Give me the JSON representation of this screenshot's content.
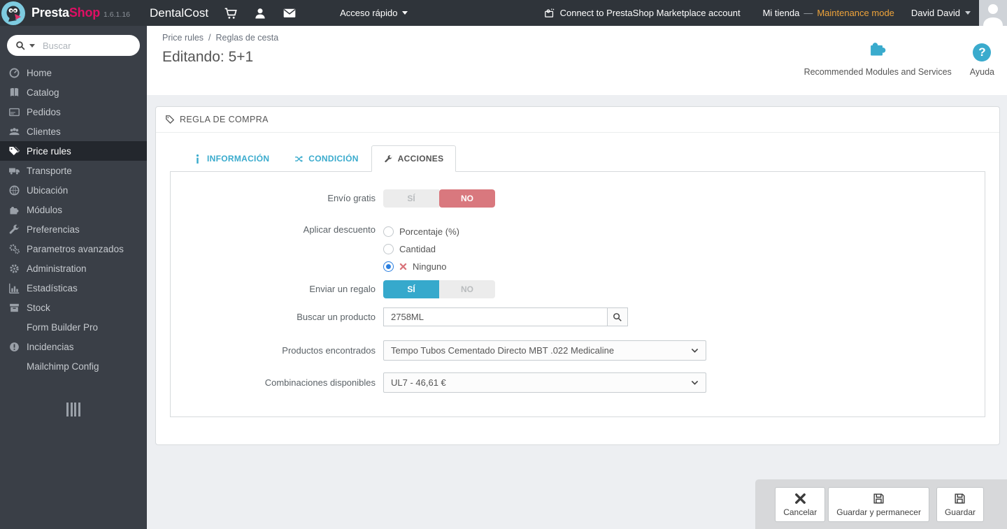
{
  "topbar": {
    "brand_presta": "Presta",
    "brand_shop": "Shop",
    "version": "1.6.1.16",
    "shop_name": "DentalCost",
    "quick_access": "Acceso rápido",
    "marketplace": "Connect to PrestaShop Marketplace account",
    "store_name": "Mi tienda",
    "store_sep": "—",
    "maintenance": "Maintenance mode",
    "user_name": "David David"
  },
  "sidebar": {
    "search_placeholder": "Buscar",
    "items": [
      {
        "label": "Home",
        "icon": "gauge-icon"
      },
      {
        "label": "Catalog",
        "icon": "book-icon"
      },
      {
        "label": "Pedidos",
        "icon": "credit-card-icon"
      },
      {
        "label": "Clientes",
        "icon": "group-icon"
      },
      {
        "label": "Price rules",
        "icon": "tags-icon",
        "active": true
      },
      {
        "label": "Transporte",
        "icon": "truck-icon"
      },
      {
        "label": "Ubicación",
        "icon": "globe-icon"
      },
      {
        "label": "Módulos",
        "icon": "puzzle-icon"
      },
      {
        "label": "Preferencias",
        "icon": "wrench-icon"
      },
      {
        "label": "Parametros avanzados",
        "icon": "gears-icon"
      },
      {
        "label": "Administration",
        "icon": "gear-icon"
      },
      {
        "label": "Estadísticas",
        "icon": "bar-chart-icon"
      },
      {
        "label": "Stock",
        "icon": "box-icon"
      },
      {
        "label": "Form Builder Pro",
        "icon": null
      },
      {
        "label": "Incidencias",
        "icon": "alert-icon"
      },
      {
        "label": "Mailchimp Config",
        "icon": null
      }
    ]
  },
  "header": {
    "breadcrumb_1": "Price rules",
    "breadcrumb_sep": "/",
    "breadcrumb_2": "Reglas de cesta",
    "title": "Editando: 5+1",
    "modules_label": "Recommended Modules and Services",
    "help_label": "Ayuda"
  },
  "panel": {
    "title": "REGLA DE COMPRA",
    "tabs": [
      {
        "label": "INFORMACIÓN"
      },
      {
        "label": "CONDICIÓN"
      },
      {
        "label": "ACCIONES",
        "active": true
      }
    ],
    "form": {
      "free_shipping": {
        "label": "Envío gratis",
        "yes": "SÍ",
        "no": "NO",
        "selected": "NO"
      },
      "discount": {
        "label": "Aplicar descuento",
        "options": [
          "Porcentaje (%)",
          "Cantidad",
          "Ninguno"
        ],
        "selected": "Ninguno"
      },
      "gift": {
        "label": "Enviar un regalo",
        "yes": "SÍ",
        "no": "NO",
        "selected": "SÍ"
      },
      "product_search": {
        "label": "Buscar un producto",
        "value": "2758ML"
      },
      "products_found": {
        "label": "Productos encontrados",
        "value": "Tempo Tubos Cementado Directo MBT .022 Medicaline"
      },
      "combinations": {
        "label": "Combinaciones disponibles",
        "value": "UL7 - 46,61 €"
      }
    }
  },
  "footer_toolbar": {
    "cancel": "Cancelar",
    "save_stay": "Guardar y permanecer",
    "save": "Guardar"
  },
  "icons": {
    "help_glyph": "?"
  },
  "colors": {
    "topbar_bg": "#2f343a",
    "sidebar_bg": "#3a3f47",
    "accent_blue": "#3aabcd",
    "toggle_on_blue": "#36a9cc",
    "toggle_off_red": "#d9787e",
    "radio_selected_blue": "#2a7fe0",
    "maintenance_orange": "#efa43a",
    "brand_pink": "#df0f64",
    "content_bg": "#edeff2"
  }
}
